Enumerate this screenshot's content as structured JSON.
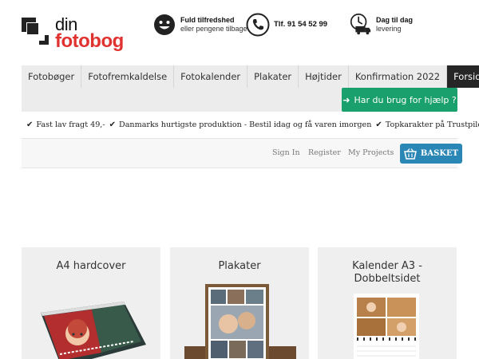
{
  "header": {
    "logo_line1": "din",
    "logo_line2": "fotobog",
    "usp_satisfaction_title": "Fuld tilfredshed",
    "usp_satisfaction_sub": "eller pengene tilbage",
    "phone": "Tlf. 91 54 52 99",
    "delivery_title": "Dag til dag",
    "delivery_sub": "levering"
  },
  "nav": {
    "items": [
      "Fotobøger",
      "Fotofremkaldelse",
      "Fotokalender",
      "Plakater",
      "Højtider",
      "Konfirmation 2022",
      "Forside"
    ],
    "help_label": "Har du brug for hjælp ?"
  },
  "usp_bar": {
    "items": [
      "Fast lav fragt 49,-",
      "Danmarks hurtigste produktion - Bestil idag og få varen imorgen",
      "Topkarakter på Trustpilot"
    ]
  },
  "account": {
    "sign_in": "Sign In",
    "register": "Register",
    "my_projects": "My Projects",
    "basket": "BASKET"
  },
  "products": [
    {
      "title": "A4 hardcover"
    },
    {
      "title": "Plakater"
    },
    {
      "title": "Kalender A3 - Dobbeltsidet"
    }
  ],
  "colors": {
    "brand_red": "#e0322f",
    "nav_active": "#262626",
    "help_green": "#1aa06d",
    "basket_blue": "#2a87b5"
  }
}
